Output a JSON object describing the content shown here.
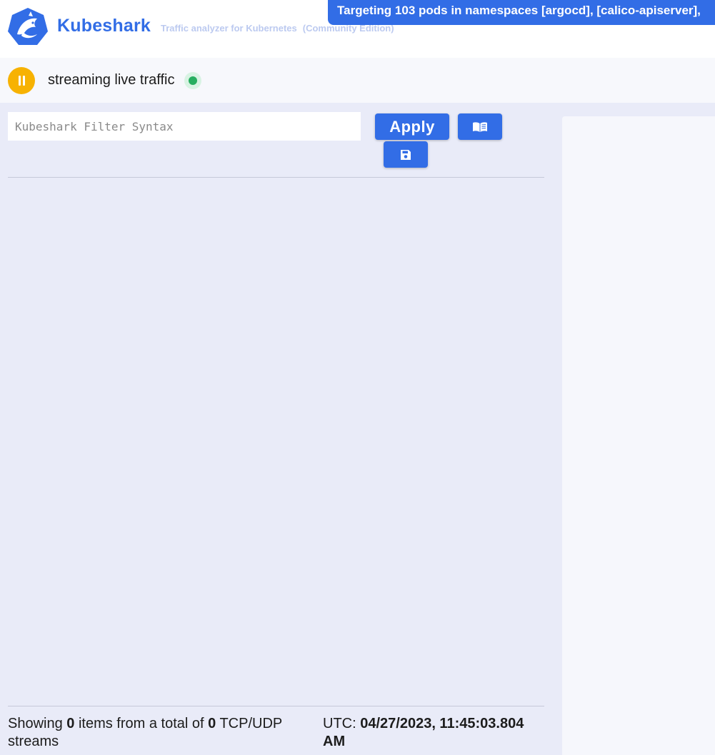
{
  "header": {
    "brand": "Kubeshark",
    "tagline": "Traffic analyzer for Kubernetes",
    "edition": "(Community Edition)",
    "targeting": "Targeting 103 pods in namespaces [argocd], [calico-apiserver],",
    "logo_icon": "kubeshark-shark-logo"
  },
  "status": {
    "pause_icon": "pause-icon",
    "text": "streaming live traffic",
    "live_indicator_color": "#27ae60"
  },
  "filter": {
    "placeholder": "Kubeshark Filter Syntax",
    "value": "",
    "apply_label": "Apply",
    "docs_icon": "book-icon",
    "save_icon": "save-icon"
  },
  "footer": {
    "prefix": "Showing ",
    "shown_count": "0",
    "middle": " items from a total of ",
    "total_count": "0",
    "suffix": " TCP/UDP streams",
    "utc_label": "UTC: ",
    "timestamp": "04/27/2023, 11:45:03.804 AM"
  },
  "colors": {
    "accent": "#326de6",
    "pause": "#f7b202",
    "background": "#e9ebf8"
  }
}
